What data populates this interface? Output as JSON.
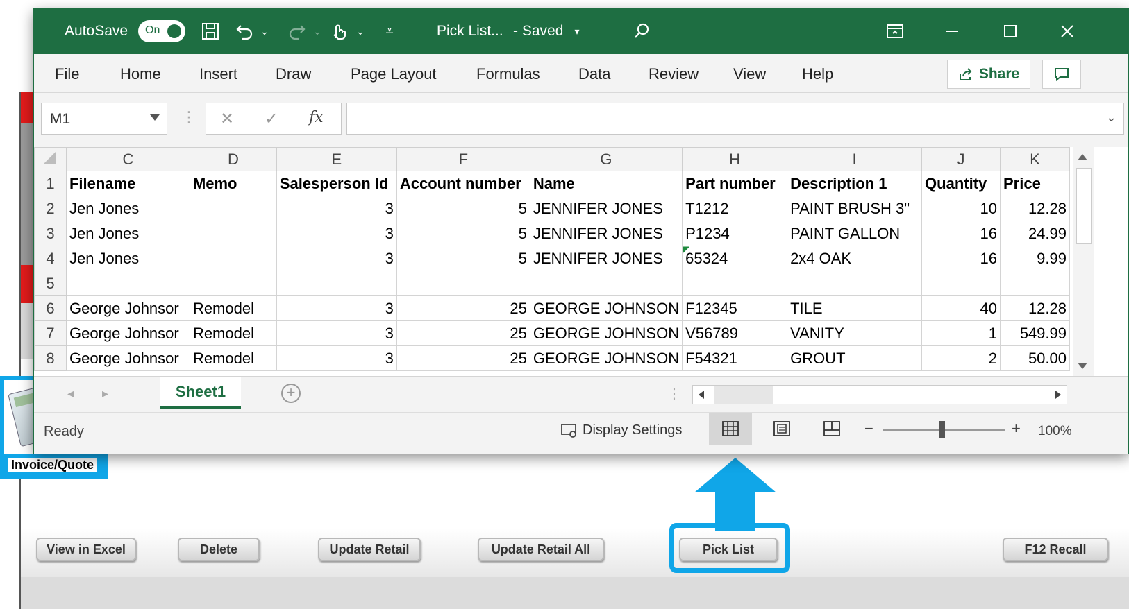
{
  "titlebar": {
    "autosave_label": "AutoSave",
    "autosave_state": "On",
    "file_name": "Pick List...",
    "save_status": "-  Saved"
  },
  "menu": {
    "items": [
      "File",
      "Home",
      "Insert",
      "Draw",
      "Page Layout",
      "Formulas",
      "Data",
      "Review",
      "View",
      "Help"
    ],
    "share_label": "Share"
  },
  "formula_bar": {
    "name_box": "M1",
    "fx_label": "fx",
    "formula_value": ""
  },
  "sheet": {
    "column_headers": [
      "C",
      "D",
      "E",
      "F",
      "G",
      "H",
      "I",
      "J",
      "K"
    ],
    "rows": [
      {
        "row": "1",
        "cells": [
          "Filename",
          "Memo",
          "Salesperson Id",
          "Account number",
          "Name",
          "Part number",
          "Description 1",
          "Quantity",
          "Price"
        ]
      },
      {
        "row": "2",
        "cells": [
          "Jen Jones",
          "",
          "3",
          "5",
          "JENNIFER JONES",
          "T1212",
          "PAINT BRUSH 3\"",
          "10",
          "12.28"
        ]
      },
      {
        "row": "3",
        "cells": [
          "Jen Jones",
          "",
          "3",
          "5",
          "JENNIFER JONES",
          "P1234",
          "PAINT GALLON",
          "16",
          "24.99"
        ]
      },
      {
        "row": "4",
        "cells": [
          "Jen Jones",
          "",
          "3",
          "5",
          "JENNIFER JONES",
          "65324",
          "2x4 OAK",
          "16",
          "9.99"
        ]
      },
      {
        "row": "5",
        "cells": [
          "",
          "",
          "",
          "",
          "",
          "",
          "",
          "",
          ""
        ]
      },
      {
        "row": "6",
        "cells": [
          "George Johnsor",
          "Remodel",
          "3",
          "25",
          "GEORGE JOHNSON",
          "F12345",
          "TILE",
          "40",
          "12.28"
        ]
      },
      {
        "row": "7",
        "cells": [
          "George Johnsor",
          "Remodel",
          "3",
          "25",
          "GEORGE JOHNSON",
          "V56789",
          "VANITY",
          "1",
          "549.99"
        ]
      },
      {
        "row": "8",
        "cells": [
          "George Johnsor",
          "Remodel",
          "3",
          "25",
          "GEORGE JOHNSON",
          "F54321",
          "GROUT",
          "2",
          "50.00"
        ]
      }
    ],
    "tab_name": "Sheet1"
  },
  "statusbar": {
    "status": "Ready",
    "display_settings": "Display Settings",
    "zoom": "100%"
  },
  "legacy_app": {
    "invoice_label": "Invoice/Quote",
    "buttons": {
      "view_in_excel": "View in Excel",
      "delete": "Delete",
      "update_retail": "Update Retail",
      "update_retail_all": "Update Retail All",
      "pick_list": "Pick List",
      "f12_recall": "F12  Recall"
    }
  },
  "colors": {
    "excel_green": "#1e6e42",
    "highlight_blue": "#10a6e8"
  }
}
